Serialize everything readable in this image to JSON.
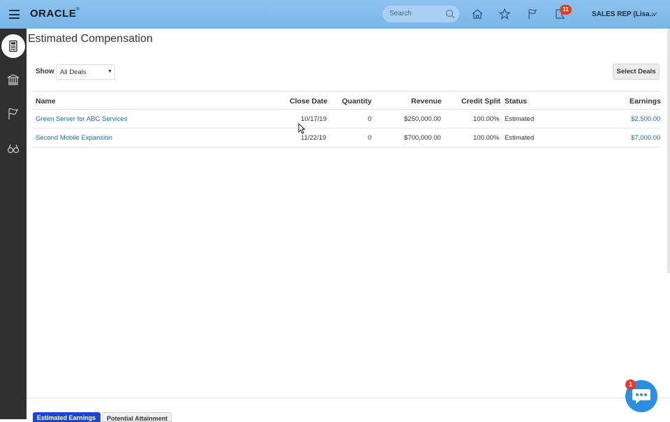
{
  "header": {
    "logo": "ORACLE",
    "logo_mark": "®",
    "search_placeholder": "Search",
    "notifications_count": "11",
    "user_label": "SALES REP (Lisa..."
  },
  "rail": {
    "items": [
      "calculator-icon",
      "bank-icon",
      "flag-icon",
      "binoculars-icon"
    ]
  },
  "page": {
    "title": "Estimated Compensation",
    "show_label": "Show",
    "show_value": "All Deals",
    "select_deals_label": "Select Deals"
  },
  "table": {
    "columns": [
      "Name",
      "Close Date",
      "Quantity",
      "Revenue",
      "Credit Split",
      "Status",
      "Earnings"
    ],
    "rows": [
      {
        "name": "Green Server for ABC Services",
        "close_date": "10/17/19",
        "quantity": "0",
        "revenue": "$250,000.00",
        "credit_split": "100.00%",
        "status": "Estimated",
        "earnings": "$2,500.00"
      },
      {
        "name": "Second Mobile Expansion",
        "close_date": "11/22/19",
        "quantity": "0",
        "revenue": "$700,000.00",
        "credit_split": "100.00%",
        "status": "Estimated",
        "earnings": "$7,000.00"
      }
    ]
  },
  "footer_tabs": {
    "active": "Estimated Earnings",
    "inactive": "Potential Attainment"
  },
  "chat": {
    "badge": "1"
  },
  "colors": {
    "topbar": "#7ab6e9",
    "rail": "#303030",
    "link": "#1b6fae",
    "tab_active": "#1b46d3",
    "badge": "#d9421c"
  }
}
